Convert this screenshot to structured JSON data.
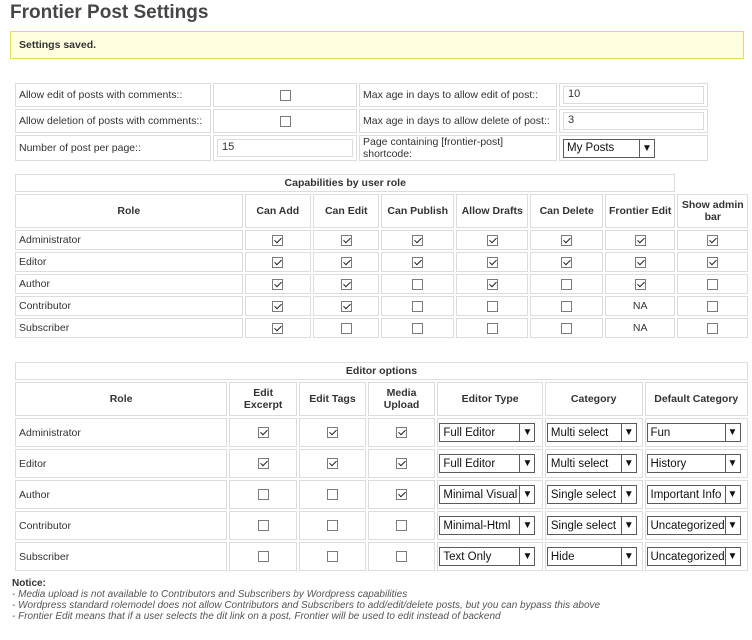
{
  "page_title": "Frontier Post Settings",
  "saved_notice": "Settings saved.",
  "general": {
    "allow_edit_comments_label": "Allow edit of posts with comments::",
    "allow_edit_comments": false,
    "max_age_edit_label": "Max age in days to allow edit of post::",
    "max_age_edit": "10",
    "allow_delete_comments_label": "Allow deletion of posts with comments::",
    "allow_delete_comments": false,
    "max_age_delete_label": "Max age in days to allow delete of post::",
    "max_age_delete": "3",
    "posts_per_page_label": "Number of post per page::",
    "posts_per_page": "15",
    "shortcode_page_label": "Page containing [frontier-post] shortcode:",
    "shortcode_page": "My Posts"
  },
  "capabilities": {
    "header": "Capabilities by user role",
    "columns": [
      "Role",
      "Can Add",
      "Can Edit",
      "Can Publish",
      "Allow Drafts",
      "Can Delete",
      "Frontier Edit",
      "Show admin bar"
    ],
    "rows": [
      {
        "role": "Administrator",
        "values": [
          true,
          true,
          true,
          true,
          true,
          true,
          true
        ]
      },
      {
        "role": "Editor",
        "values": [
          true,
          true,
          true,
          true,
          true,
          true,
          true
        ]
      },
      {
        "role": "Author",
        "values": [
          true,
          true,
          false,
          true,
          false,
          true,
          false
        ]
      },
      {
        "role": "Contributor",
        "values": [
          true,
          true,
          false,
          false,
          false,
          "NA",
          false
        ]
      },
      {
        "role": "Subscriber",
        "values": [
          true,
          false,
          false,
          false,
          false,
          "NA",
          false
        ]
      }
    ]
  },
  "editor_options": {
    "header": "Editor options",
    "columns": [
      "Role",
      "Edit Excerpt",
      "Edit Tags",
      "Media Upload",
      "Editor Type",
      "Category",
      "Default Category"
    ],
    "rows": [
      {
        "role": "Administrator",
        "excerpt": true,
        "tags": true,
        "media": true,
        "editor_type": "Full Editor",
        "category": "Multi select",
        "default_category": "Fun"
      },
      {
        "role": "Editor",
        "excerpt": true,
        "tags": true,
        "media": true,
        "editor_type": "Full Editor",
        "category": "Multi select",
        "default_category": "History"
      },
      {
        "role": "Author",
        "excerpt": false,
        "tags": false,
        "media": true,
        "editor_type": "Minimal Visual",
        "category": "Single select",
        "default_category": "Important Info"
      },
      {
        "role": "Contributor",
        "excerpt": false,
        "tags": false,
        "media": false,
        "editor_type": "Minimal-Html",
        "category": "Single select",
        "default_category": "Uncategorized"
      },
      {
        "role": "Subscriber",
        "excerpt": false,
        "tags": false,
        "media": false,
        "editor_type": "Text Only",
        "category": "Hide",
        "default_category": "Uncategorized"
      }
    ]
  },
  "notice": {
    "title": "Notice:",
    "lines": [
      "- Media upload is not available to Contributors and Subscribers by Wordpress capabilities",
      "- Wordpress standard rolemodel does not allow Contributors and Subscribers to add/edit/delete posts, but you can bypass this above",
      "- Frontier Edit means that if a user selects the dit link on a post, Frontier will be used to edit instead of backend"
    ]
  },
  "icons": {
    "dropdown": "chevron-down-icon",
    "check": "checkmark-icon"
  }
}
